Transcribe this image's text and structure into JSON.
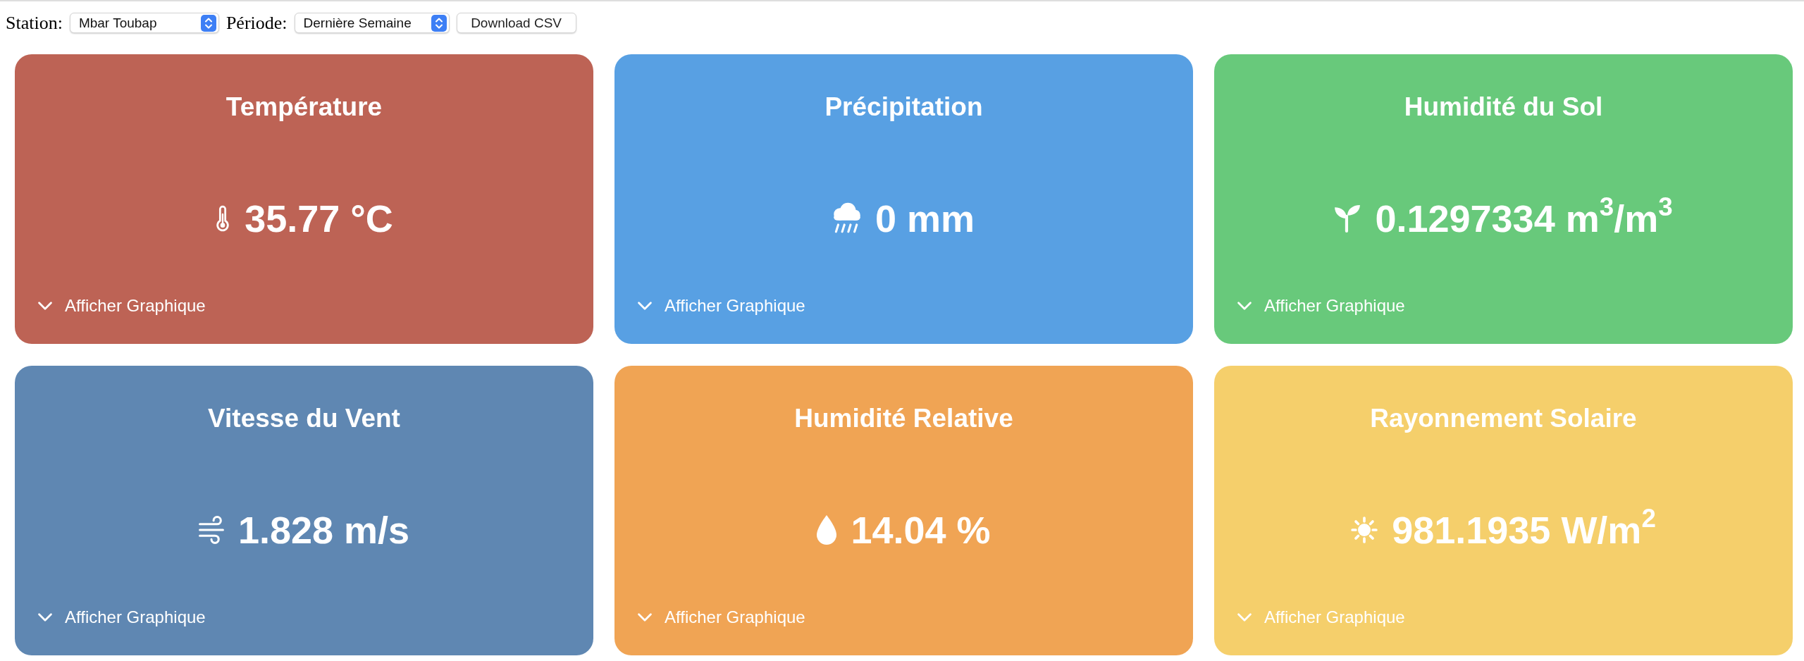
{
  "toolbar": {
    "station": {
      "label": "Station:",
      "value": "Mbar Toubap"
    },
    "period": {
      "label": "Période:",
      "value": "Dernière Semaine"
    },
    "download_button": "Download CSV"
  },
  "cards": [
    {
      "kind": "temperature",
      "title": "Température",
      "value": "35.77 °C",
      "color": "#bd6355",
      "toggle": "Afficher Graphique"
    },
    {
      "kind": "precipitation",
      "title": "Précipitation",
      "value": "0 mm",
      "color": "#58a0e3",
      "toggle": "Afficher Graphique"
    },
    {
      "kind": "soil_moisture",
      "title": "Humidité du Sol",
      "value": "0.1297334 m$^{3}$/m$^{3}$",
      "color": "#68c97b",
      "toggle": "Afficher Graphique"
    },
    {
      "kind": "wind",
      "title": "Vitesse du Vent",
      "value": "1.828 m/s",
      "color": "#5f87b2",
      "toggle": "Afficher Graphique"
    },
    {
      "kind": "humidity",
      "title": "Humidité Relative",
      "value": "14.04 %",
      "color": "#f0a454",
      "toggle": "Afficher Graphique"
    },
    {
      "kind": "solar",
      "title": "Rayonnement Solaire",
      "value": "981.1935 W/m$^{2}$",
      "color": "#f5cf6b",
      "toggle": "Afficher Graphique"
    }
  ]
}
